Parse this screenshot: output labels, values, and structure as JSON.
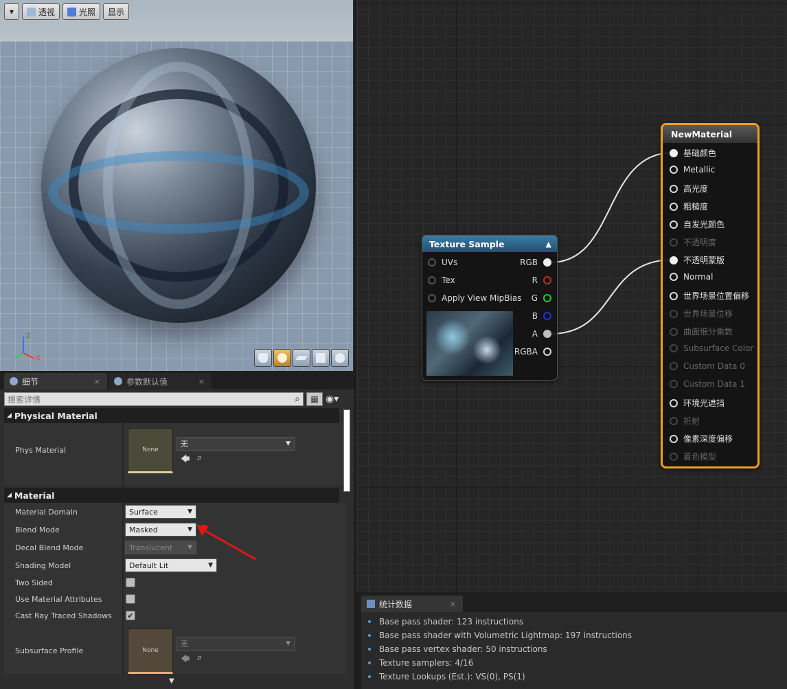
{
  "viewport": {
    "menu_arrow": "▾",
    "perspective_label": "透视",
    "lit_label": "光照",
    "show_label": "显示",
    "axis": {
      "z": "Z",
      "x": "X"
    }
  },
  "details": {
    "tabs": [
      {
        "label": "细节",
        "close": "×"
      },
      {
        "label": "参数默认值",
        "close": "×"
      }
    ],
    "search_placeholder": "搜索详情",
    "sections": {
      "physical": {
        "title": "Physical Material",
        "phys_material_label": "Phys Material",
        "phys_thumb_text": "None",
        "phys_value": "无"
      },
      "material": {
        "title": "Material",
        "domain_label": "Material Domain",
        "domain_value": "Surface",
        "blend_label": "Blend Mode",
        "blend_value": "Masked",
        "decal_label": "Decal Blend Mode",
        "decal_value": "Translucent",
        "shading_label": "Shading Model",
        "shading_value": "Default Lit",
        "two_sided_label": "Two Sided",
        "use_attr_label": "Use Material Attributes",
        "cast_shadow_label": "Cast Ray Traced Shadows",
        "subsurface_label": "Subsurface Profile",
        "subsurface_thumb_text": "None",
        "subsurface_value": "无"
      }
    },
    "checkboxes": {
      "two_sided": false,
      "use_material_attributes": false,
      "cast_ray_traced_shadows": true
    }
  },
  "texture_node": {
    "title": "Texture Sample",
    "inputs": [
      "UVs",
      "Tex",
      "Apply View MipBias"
    ],
    "outputs": [
      "RGB",
      "R",
      "G",
      "B",
      "A",
      "RGBA"
    ]
  },
  "material_node": {
    "title": "NewMaterial",
    "pins": [
      {
        "label": "基础颜色",
        "enabled": true,
        "connected": true
      },
      {
        "label": "Metallic",
        "enabled": true,
        "connected": false
      },
      {
        "label": "高光度",
        "enabled": true,
        "connected": false
      },
      {
        "label": "粗糙度",
        "enabled": true,
        "connected": false
      },
      {
        "label": "自发光颜色",
        "enabled": true,
        "connected": false
      },
      {
        "label": "不透明度",
        "enabled": false,
        "connected": false
      },
      {
        "label": "不透明蒙版",
        "enabled": true,
        "connected": true
      },
      {
        "label": "Normal",
        "enabled": true,
        "connected": false
      },
      {
        "label": "世界场景位置偏移",
        "enabled": true,
        "connected": false
      },
      {
        "label": "世界场景位移",
        "enabled": false,
        "connected": false
      },
      {
        "label": "曲面细分乘数",
        "enabled": false,
        "connected": false
      },
      {
        "label": "Subsurface Color",
        "enabled": false,
        "connected": false
      },
      {
        "label": "Custom Data 0",
        "enabled": false,
        "connected": false
      },
      {
        "label": "Custom Data 1",
        "enabled": false,
        "connected": false
      },
      {
        "label": "环境光遮挡",
        "enabled": true,
        "connected": false
      },
      {
        "label": "折射",
        "enabled": false,
        "connected": false
      },
      {
        "label": "像素深度偏移",
        "enabled": true,
        "connected": false
      },
      {
        "label": "着色模型",
        "enabled": false,
        "connected": false
      }
    ]
  },
  "stats": {
    "tab_label": "统计数据",
    "tab_close": "×",
    "lines": [
      "Base pass shader: 123 instructions",
      "Base pass shader with Volumetric Lightmap: 197 instructions",
      "Base pass vertex shader: 50 instructions",
      "Texture samplers: 4/16",
      "Texture Lookups (Est.): VS(0), PS(1)"
    ]
  },
  "colors": {
    "accent_orange": "#f0a020",
    "node_header_blue": "#3a7ca6",
    "annotation_arrow": "#e01818"
  }
}
